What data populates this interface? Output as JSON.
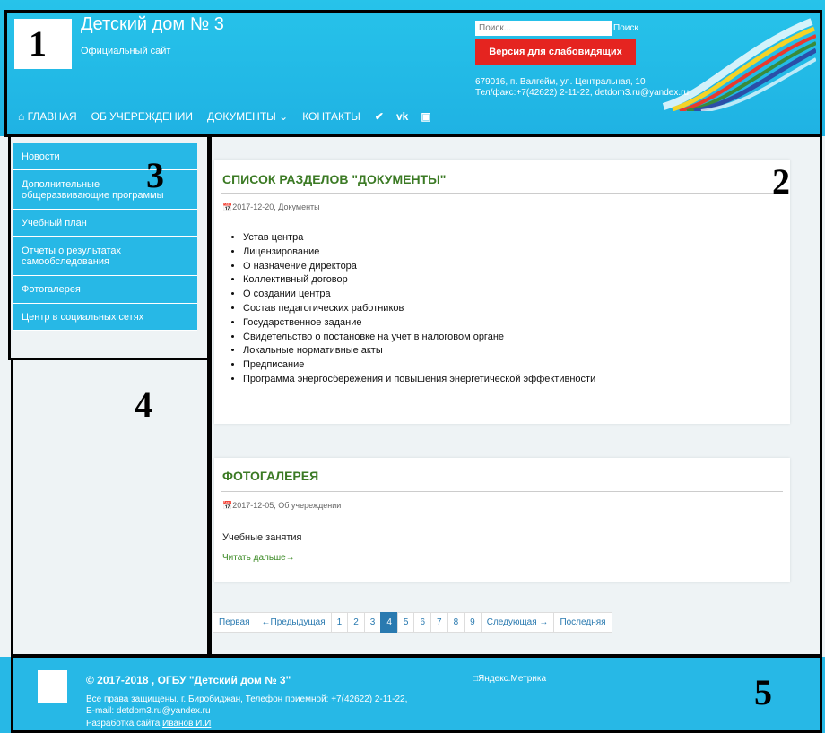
{
  "header": {
    "title": "Детский дом № 3",
    "subtitle": "Официальный сайт",
    "search_placeholder": "Поиск...",
    "search_button": "Поиск",
    "vision_button": "Версия для слабовидящих",
    "address": "679016, п. Валгейм, ул. Центральная, 10",
    "contacts": "Тел/факс:+7(42622) 2-11-22, detdom3.ru@yandex.ru"
  },
  "nav": {
    "home": "ГЛАВНАЯ",
    "about": "ОБ УЧЕРЕЖДЕНИИ",
    "documents": "ДОКУМЕНТЫ",
    "contacts": "КОНТАКТЫ",
    "social_icons": [
      "twitter-icon",
      "vk-icon",
      "instagram-icon"
    ]
  },
  "sidebar": {
    "items": [
      "Новости",
      "Дополнительные общеразвивающие программы",
      "Учебный план",
      "Отчеты о результатах самообследования",
      "Фотогалерея",
      "Центр в социальных сетях"
    ]
  },
  "posts": [
    {
      "title": "СПИСОК РАЗДЕЛОВ \"ДОКУМЕНТЫ\"",
      "meta": "2017-12-20, Документы",
      "items": [
        "Устав центра",
        "Лицензирование",
        "О назначение директора",
        "Коллективный договор",
        "О создании центра",
        "Состав педагогических работников",
        "Государственное задание",
        "Свидетельство о постановке на учет в налоговом органе",
        "Локальные нормативные акты",
        "Предписание",
        "Программа энергосбережения и повышения энергетической эффективности"
      ]
    },
    {
      "title": "ФОТОГАЛЕРЕЯ",
      "meta": "2017-12-05, Об учереждении",
      "text": "Учебные занятия",
      "read_more": "Читать дальше→"
    }
  ],
  "pagination": {
    "first": "Первая",
    "prev": "←Предыдущая",
    "pages": [
      "1",
      "2",
      "3",
      "4",
      "5",
      "6",
      "7",
      "8",
      "9"
    ],
    "active": "4",
    "next": "Следующая →",
    "last": "Последняя"
  },
  "footer": {
    "copyright": "© 2017-2018 , ОГБУ \"Детский дом № 3\"",
    "rights": "Все права защищены. г. Биробиджан, Телефон приемной: +7(42622) 2-11-22,",
    "email": "E-mail: detdom3.ru@yandex.ru",
    "dev_prefix": "Разработка сайта ",
    "dev_name": "Иванов И.И",
    "metrika": "Яндекс.Метрика"
  },
  "annotations": [
    "1",
    "2",
    "3",
    "4",
    "5"
  ],
  "colors": {
    "header_bg": "#1fb2e3",
    "sidebar_bg": "#27b8e6",
    "vision_button": "#e52420",
    "title_green": "#3b7a24",
    "pager_active": "#2a7ab0"
  }
}
